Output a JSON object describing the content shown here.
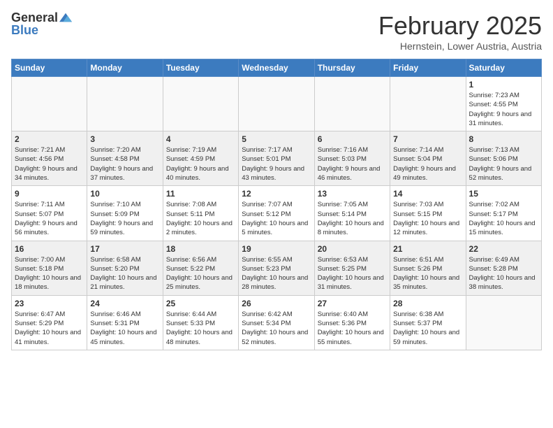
{
  "header": {
    "logo_general": "General",
    "logo_blue": "Blue",
    "month": "February 2025",
    "location": "Hernstein, Lower Austria, Austria"
  },
  "weekdays": [
    "Sunday",
    "Monday",
    "Tuesday",
    "Wednesday",
    "Thursday",
    "Friday",
    "Saturday"
  ],
  "weeks": [
    [
      {
        "day": "",
        "info": ""
      },
      {
        "day": "",
        "info": ""
      },
      {
        "day": "",
        "info": ""
      },
      {
        "day": "",
        "info": ""
      },
      {
        "day": "",
        "info": ""
      },
      {
        "day": "",
        "info": ""
      },
      {
        "day": "1",
        "info": "Sunrise: 7:23 AM\nSunset: 4:55 PM\nDaylight: 9 hours and 31 minutes."
      }
    ],
    [
      {
        "day": "2",
        "info": "Sunrise: 7:21 AM\nSunset: 4:56 PM\nDaylight: 9 hours and 34 minutes."
      },
      {
        "day": "3",
        "info": "Sunrise: 7:20 AM\nSunset: 4:58 PM\nDaylight: 9 hours and 37 minutes."
      },
      {
        "day": "4",
        "info": "Sunrise: 7:19 AM\nSunset: 4:59 PM\nDaylight: 9 hours and 40 minutes."
      },
      {
        "day": "5",
        "info": "Sunrise: 7:17 AM\nSunset: 5:01 PM\nDaylight: 9 hours and 43 minutes."
      },
      {
        "day": "6",
        "info": "Sunrise: 7:16 AM\nSunset: 5:03 PM\nDaylight: 9 hours and 46 minutes."
      },
      {
        "day": "7",
        "info": "Sunrise: 7:14 AM\nSunset: 5:04 PM\nDaylight: 9 hours and 49 minutes."
      },
      {
        "day": "8",
        "info": "Sunrise: 7:13 AM\nSunset: 5:06 PM\nDaylight: 9 hours and 52 minutes."
      }
    ],
    [
      {
        "day": "9",
        "info": "Sunrise: 7:11 AM\nSunset: 5:07 PM\nDaylight: 9 hours and 56 minutes."
      },
      {
        "day": "10",
        "info": "Sunrise: 7:10 AM\nSunset: 5:09 PM\nDaylight: 9 hours and 59 minutes."
      },
      {
        "day": "11",
        "info": "Sunrise: 7:08 AM\nSunset: 5:11 PM\nDaylight: 10 hours and 2 minutes."
      },
      {
        "day": "12",
        "info": "Sunrise: 7:07 AM\nSunset: 5:12 PM\nDaylight: 10 hours and 5 minutes."
      },
      {
        "day": "13",
        "info": "Sunrise: 7:05 AM\nSunset: 5:14 PM\nDaylight: 10 hours and 8 minutes."
      },
      {
        "day": "14",
        "info": "Sunrise: 7:03 AM\nSunset: 5:15 PM\nDaylight: 10 hours and 12 minutes."
      },
      {
        "day": "15",
        "info": "Sunrise: 7:02 AM\nSunset: 5:17 PM\nDaylight: 10 hours and 15 minutes."
      }
    ],
    [
      {
        "day": "16",
        "info": "Sunrise: 7:00 AM\nSunset: 5:18 PM\nDaylight: 10 hours and 18 minutes."
      },
      {
        "day": "17",
        "info": "Sunrise: 6:58 AM\nSunset: 5:20 PM\nDaylight: 10 hours and 21 minutes."
      },
      {
        "day": "18",
        "info": "Sunrise: 6:56 AM\nSunset: 5:22 PM\nDaylight: 10 hours and 25 minutes."
      },
      {
        "day": "19",
        "info": "Sunrise: 6:55 AM\nSunset: 5:23 PM\nDaylight: 10 hours and 28 minutes."
      },
      {
        "day": "20",
        "info": "Sunrise: 6:53 AM\nSunset: 5:25 PM\nDaylight: 10 hours and 31 minutes."
      },
      {
        "day": "21",
        "info": "Sunrise: 6:51 AM\nSunset: 5:26 PM\nDaylight: 10 hours and 35 minutes."
      },
      {
        "day": "22",
        "info": "Sunrise: 6:49 AM\nSunset: 5:28 PM\nDaylight: 10 hours and 38 minutes."
      }
    ],
    [
      {
        "day": "23",
        "info": "Sunrise: 6:47 AM\nSunset: 5:29 PM\nDaylight: 10 hours and 41 minutes."
      },
      {
        "day": "24",
        "info": "Sunrise: 6:46 AM\nSunset: 5:31 PM\nDaylight: 10 hours and 45 minutes."
      },
      {
        "day": "25",
        "info": "Sunrise: 6:44 AM\nSunset: 5:33 PM\nDaylight: 10 hours and 48 minutes."
      },
      {
        "day": "26",
        "info": "Sunrise: 6:42 AM\nSunset: 5:34 PM\nDaylight: 10 hours and 52 minutes."
      },
      {
        "day": "27",
        "info": "Sunrise: 6:40 AM\nSunset: 5:36 PM\nDaylight: 10 hours and 55 minutes."
      },
      {
        "day": "28",
        "info": "Sunrise: 6:38 AM\nSunset: 5:37 PM\nDaylight: 10 hours and 59 minutes."
      },
      {
        "day": "",
        "info": ""
      }
    ]
  ]
}
